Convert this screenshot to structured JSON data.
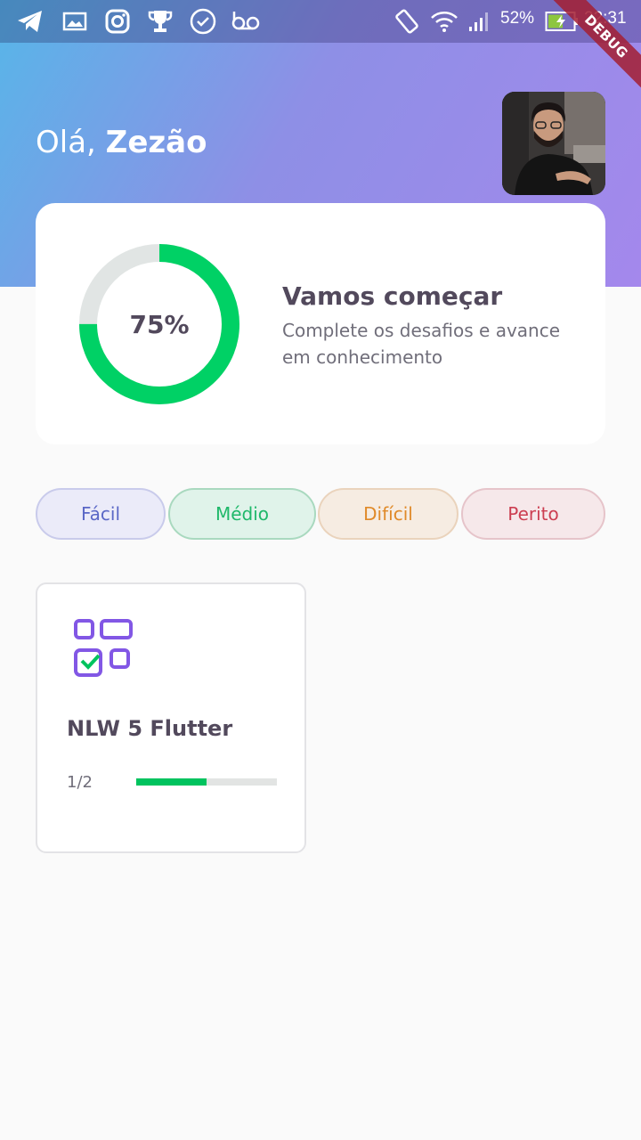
{
  "status_bar": {
    "battery_percent": "52%",
    "time": "22:31",
    "notification_icons": [
      "telegram-icon",
      "gallery-icon",
      "instagram-icon",
      "trophy-icon",
      "check-circle-icon",
      "voicemail-icon"
    ]
  },
  "debug_banner": "DEBUG",
  "header": {
    "greeting_prefix": "Olá, ",
    "user_name": "Zezão",
    "avatar_icon": "user-photo"
  },
  "score_card": {
    "percent": 0.75,
    "percent_label": "75%",
    "title": "Vamos começar",
    "subtitle": "Complete os desafios e avance em conhecimento"
  },
  "levels": [
    {
      "label": "Fácil",
      "text_color": "#5a67c6",
      "bg": "#ebebf9",
      "border": "#c9cbeb"
    },
    {
      "label": "Médio",
      "text_color": "#1fb86a",
      "bg": "#e0f3ea",
      "border": "#a9d9bf"
    },
    {
      "label": "Difícil",
      "text_color": "#e08a29",
      "bg": "#f6ece2",
      "border": "#ead3bc"
    },
    {
      "label": "Perito",
      "text_color": "#cc3f52",
      "bg": "#f6e8ea",
      "border": "#e6c4ca"
    }
  ],
  "quizzes": [
    {
      "title": "NLW 5 Flutter",
      "progress_label": "1/2",
      "progress": 0.5,
      "icon": "data-quiz-icon"
    }
  ],
  "colors": {
    "accent_green": "#00d165",
    "ring_track": "#e1e5e4",
    "text_dark": "#52495c",
    "icon_purple": "#8257e5"
  }
}
